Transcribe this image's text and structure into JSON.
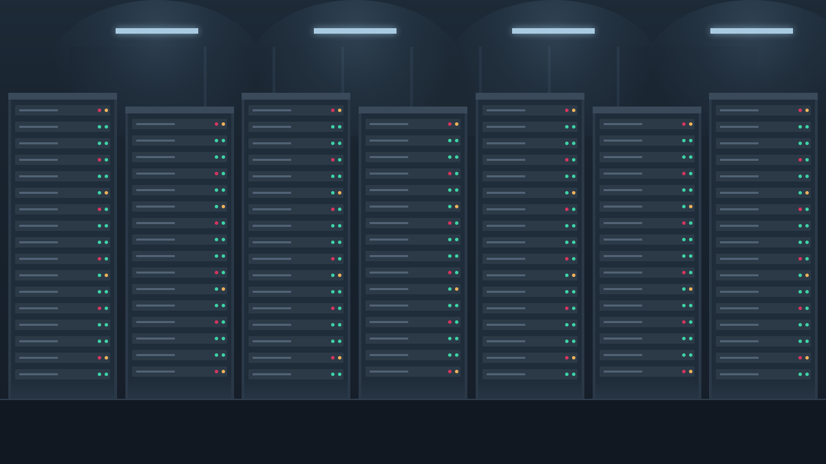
{
  "scene": {
    "racks": [
      {
        "leds": [
          "RY",
          "GG",
          "GG",
          "RG",
          "GG",
          "GY",
          "RG",
          "GG",
          "GG",
          "RG",
          "GY",
          "GG",
          "RG",
          "GG",
          "GG",
          "RY",
          "GG"
        ]
      },
      {
        "leds": [
          "RY",
          "GG",
          "GG",
          "RG",
          "GG",
          "GY",
          "RG",
          "GG",
          "GG",
          "RG",
          "GY",
          "GG",
          "RG",
          "GG",
          "GG",
          "RY"
        ]
      },
      {
        "leds": [
          "RY",
          "GG",
          "GG",
          "RG",
          "GG",
          "GY",
          "RG",
          "GG",
          "GG",
          "RG",
          "GY",
          "GG",
          "RG",
          "GG",
          "GG",
          "RY",
          "GG"
        ]
      },
      {
        "leds": [
          "RY",
          "GG",
          "GG",
          "RG",
          "GG",
          "GY",
          "RG",
          "GG",
          "GG",
          "RG",
          "GY",
          "GG",
          "RG",
          "GG",
          "GG",
          "RY"
        ]
      },
      {
        "leds": [
          "RY",
          "GG",
          "GG",
          "RG",
          "GG",
          "GY",
          "RG",
          "GG",
          "GG",
          "RG",
          "GY",
          "GG",
          "RG",
          "GG",
          "GG",
          "RY",
          "GG"
        ]
      },
      {
        "leds": [
          "RY",
          "GG",
          "GG",
          "RG",
          "GG",
          "GY",
          "RG",
          "GG",
          "GG",
          "RG",
          "GY",
          "GG",
          "RG",
          "GG",
          "GG",
          "RY"
        ]
      },
      {
        "leds": [
          "RY",
          "GG",
          "GG",
          "RG",
          "GG",
          "GY",
          "RG",
          "GG",
          "GG",
          "RG",
          "GY",
          "GG",
          "RG",
          "GG",
          "GG",
          "RY",
          "GG"
        ]
      }
    ],
    "led_colors": {
      "R": "#d9355e",
      "G": "#3ed6a6",
      "Y": "#f2b45a"
    },
    "ceiling_lights": 4
  }
}
